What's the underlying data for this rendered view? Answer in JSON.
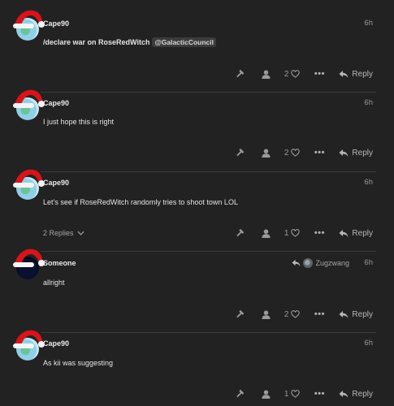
{
  "posts": [
    {
      "username": "Cape90",
      "time": "6h",
      "text": "/declare war on RoseRedWitch",
      "mention": "@GalacticCouncil",
      "likes": "2",
      "reply_label": "Reply",
      "avatar": "globe"
    },
    {
      "username": "Cape90",
      "time": "6h",
      "text": "I just hope this is right",
      "likes": "2",
      "reply_label": "Reply",
      "avatar": "globe"
    },
    {
      "username": "Cape90",
      "time": "6h",
      "text": "Let’s see if RoseRedWitch randomly tries to shoot town LOL",
      "replies_label": "2 Replies",
      "likes": "1",
      "reply_label": "Reply",
      "avatar": "globe"
    },
    {
      "username": "Someone",
      "time": "6h",
      "text": "allright",
      "reply_to": "Zugzwang",
      "likes": "2",
      "reply_label": "Reply",
      "avatar": "dark"
    },
    {
      "username": "Cape90",
      "time": "6h",
      "text": "As kii was suggesting",
      "likes": "1",
      "reply_label": "Reply",
      "avatar": "globe"
    }
  ],
  "icons": {
    "flag": "hammer-icon",
    "who_liked": "person-icon",
    "like": "heart-icon",
    "more": "ellipsis-icon",
    "reply": "reply-arrow-icon",
    "expand": "chevron-down-icon"
  },
  "colors": {
    "background": "#222222",
    "text": "#dddddd",
    "muted": "#9a9a9a",
    "hat_red": "#d7141a"
  }
}
